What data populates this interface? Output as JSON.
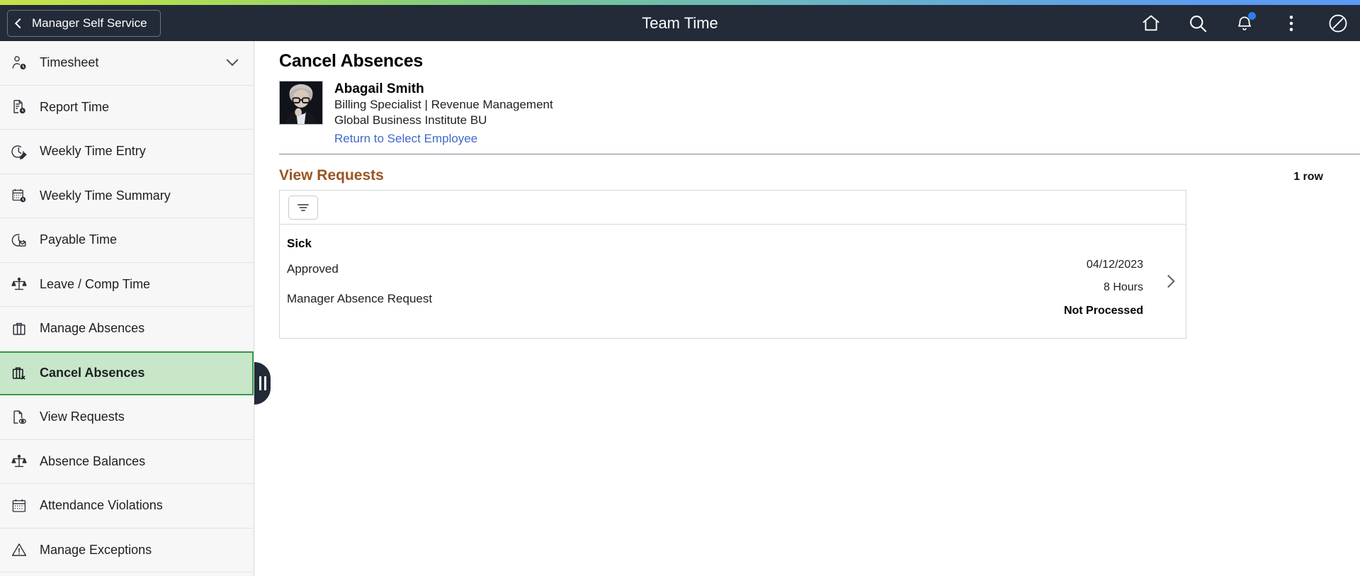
{
  "header": {
    "back_label": "Manager Self Service",
    "title": "Team Time",
    "icons": [
      {
        "name": "home-icon",
        "label": "Home"
      },
      {
        "name": "search-icon",
        "label": "Search"
      },
      {
        "name": "notifications-icon",
        "label": "Notifications"
      },
      {
        "name": "actions-menu-icon",
        "label": "Actions"
      },
      {
        "name": "navbar-icon",
        "label": "NavBar"
      }
    ],
    "notification_badge": true,
    "gradient_colors": [
      "#c6e34b",
      "#74c49a",
      "#5b9bf5"
    ],
    "background_color": "#232a38"
  },
  "sidebar": {
    "items": [
      {
        "label": "Timesheet",
        "icon": "person-clock-icon",
        "selected": false,
        "expandable": true
      },
      {
        "label": "Report Time",
        "icon": "document-clock-icon",
        "selected": false,
        "expandable": false
      },
      {
        "label": "Weekly Time Entry",
        "icon": "clock-edit-icon",
        "selected": false,
        "expandable": false
      },
      {
        "label": "Weekly Time Summary",
        "icon": "calendar-clock-icon",
        "selected": false,
        "expandable": false
      },
      {
        "label": "Payable Time",
        "icon": "clock-payment-icon",
        "selected": false,
        "expandable": false
      },
      {
        "label": "Leave / Comp Time",
        "icon": "scales-icon",
        "selected": false,
        "expandable": false
      },
      {
        "label": "Manage Absences",
        "icon": "briefcase-icon",
        "selected": false,
        "expandable": false
      },
      {
        "label": "Cancel Absences",
        "icon": "briefcase-cancel-icon",
        "selected": true,
        "expandable": false
      },
      {
        "label": "View Requests",
        "icon": "document-eye-icon",
        "selected": false,
        "expandable": false
      },
      {
        "label": "Absence Balances",
        "icon": "scales-icon",
        "selected": false,
        "expandable": false
      },
      {
        "label": "Attendance Violations",
        "icon": "calendar-icon",
        "selected": false,
        "expandable": false
      },
      {
        "label": "Manage Exceptions",
        "icon": "warning-triangle-icon",
        "selected": false,
        "expandable": false
      }
    ],
    "selected_background": "#c8e6c9",
    "selected_border": "#3a9b4d"
  },
  "main": {
    "page_title": "Cancel Absences",
    "employee": {
      "name": "Abagail Smith",
      "job_title": "Billing Specialist | Revenue Management",
      "business_unit": "Global Business Institute BU",
      "return_link": "Return to Select Employee"
    },
    "section": {
      "title": "View Requests",
      "title_color": "#9a5522",
      "row_count": "1 row"
    },
    "grid": {
      "filter_button_label": "Filter",
      "rows": [
        {
          "absence_name": "Sick",
          "status": "Approved",
          "request_source": "Manager Absence Request",
          "date": "04/12/2023",
          "duration": "8 Hours",
          "process_status": "Not Processed"
        }
      ]
    }
  }
}
